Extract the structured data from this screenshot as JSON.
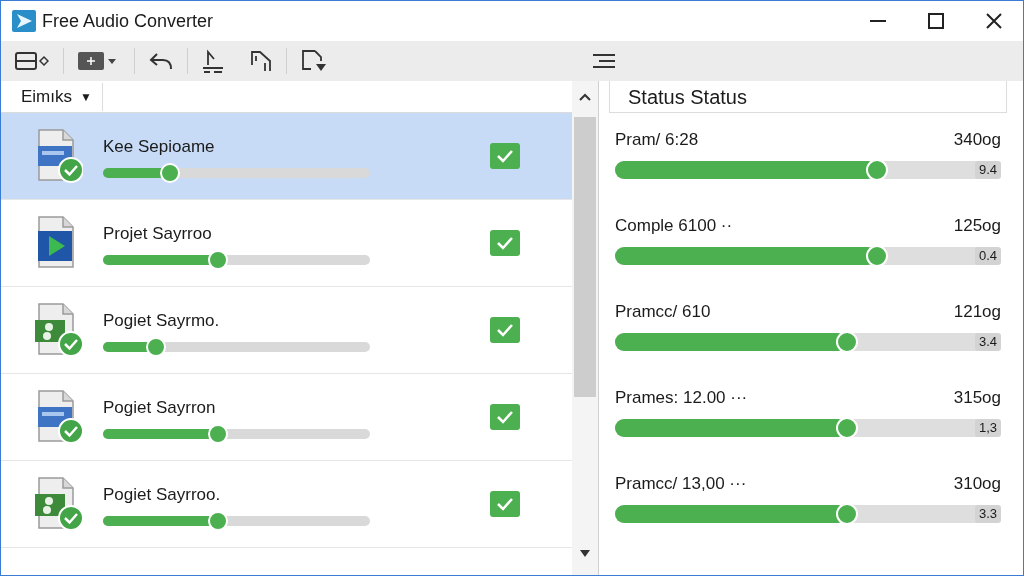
{
  "window": {
    "title": "Free Audio Converter"
  },
  "list_header": {
    "label": "Eimıks",
    "caret": "▼"
  },
  "files": [
    {
      "name": "Kee Sepioame",
      "kind": "document",
      "badge": true,
      "level": 0.25,
      "checked": true,
      "selected": true
    },
    {
      "name": "Projet Sayrroo",
      "kind": "video",
      "badge": false,
      "level": 0.43,
      "checked": true,
      "selected": false
    },
    {
      "name": "Pogiet Sayrmo.",
      "kind": "image",
      "badge": true,
      "level": 0.2,
      "checked": true,
      "selected": false
    },
    {
      "name": "Pogiet Sayrron",
      "kind": "document",
      "badge": true,
      "level": 0.43,
      "checked": true,
      "selected": false
    },
    {
      "name": "Pogiet Sayrroo.",
      "kind": "image",
      "badge": true,
      "level": 0.43,
      "checked": true,
      "selected": false
    }
  ],
  "status": {
    "title": "Status Status",
    "items": [
      {
        "label": "Pram/ 6:28",
        "value": "340og",
        "reading": "9.4",
        "level": 0.68
      },
      {
        "label": "Comple 6100 ··",
        "value": "125og",
        "reading": "0.4",
        "level": 0.68
      },
      {
        "label": "Pramcc/ 610",
        "value": "121og",
        "reading": "3.4",
        "level": 0.6
      },
      {
        "label": "Prames: 12.00 ···",
        "value": "315og",
        "reading": "1,3",
        "level": 0.6
      },
      {
        "label": "Pramcc/ 13,00 ···",
        "value": "310og",
        "reading": "3.3",
        "level": 0.6
      }
    ]
  }
}
